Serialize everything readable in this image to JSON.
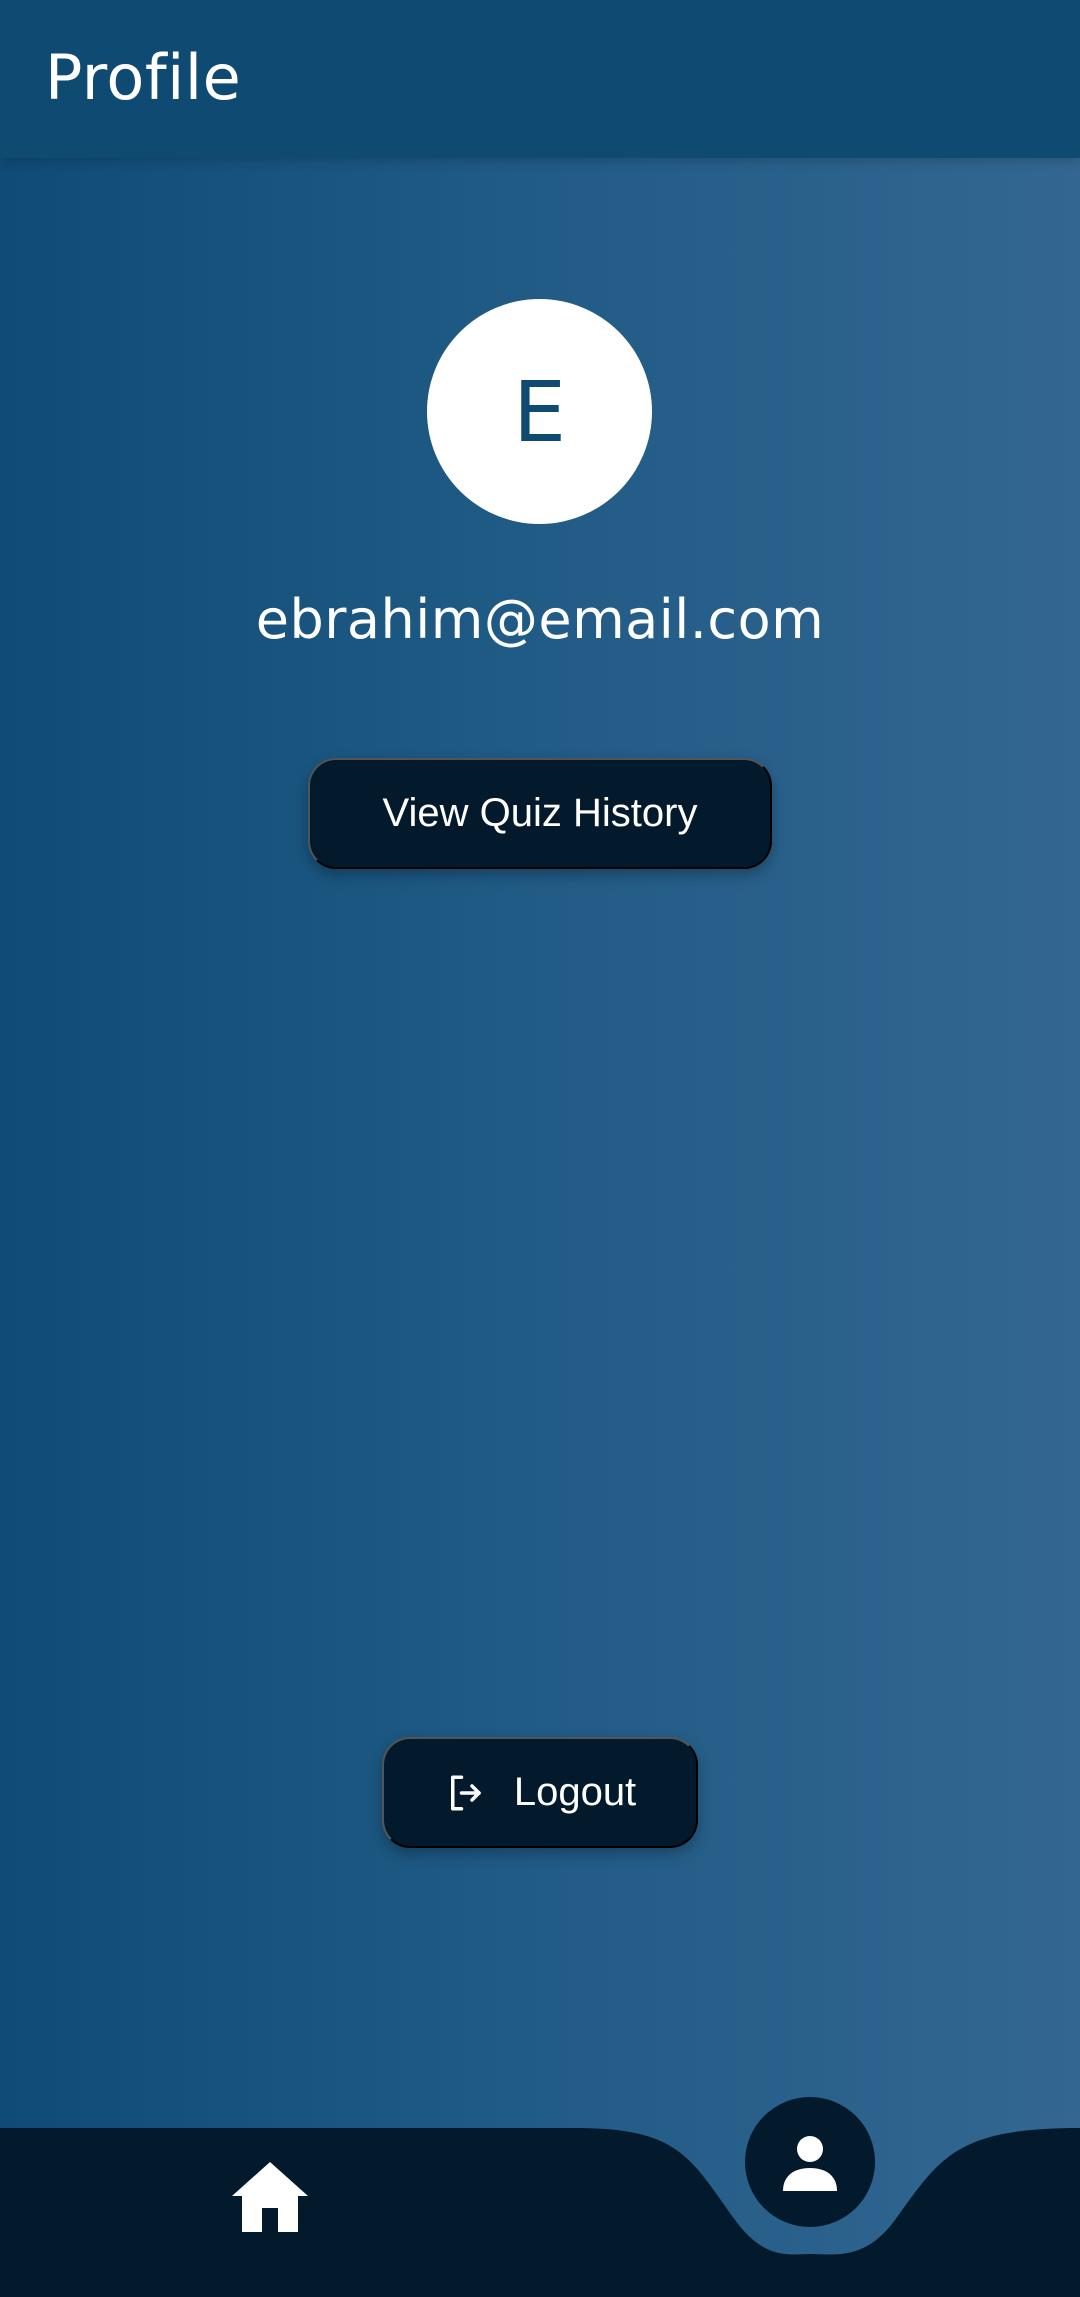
{
  "app_bar": {
    "title": "Profile"
  },
  "profile": {
    "avatar_letter": "E",
    "email": "ebrahim@email.com"
  },
  "actions": {
    "history_label": "View Quiz History",
    "logout_label": "Logout",
    "logout_icon": "logout-icon"
  },
  "bottom_nav": {
    "items": [
      {
        "name": "home",
        "icon": "home-icon",
        "active": false
      },
      {
        "name": "profile",
        "icon": "person-icon",
        "active": true
      }
    ]
  },
  "colors": {
    "app_bar": "#0f4a72",
    "background_start": "#0f4b75",
    "background_end": "#336791",
    "button": "#031a2d",
    "nav_bar": "#031a2d",
    "avatar": "#ffffff",
    "avatar_letter": "#0f4a72"
  }
}
